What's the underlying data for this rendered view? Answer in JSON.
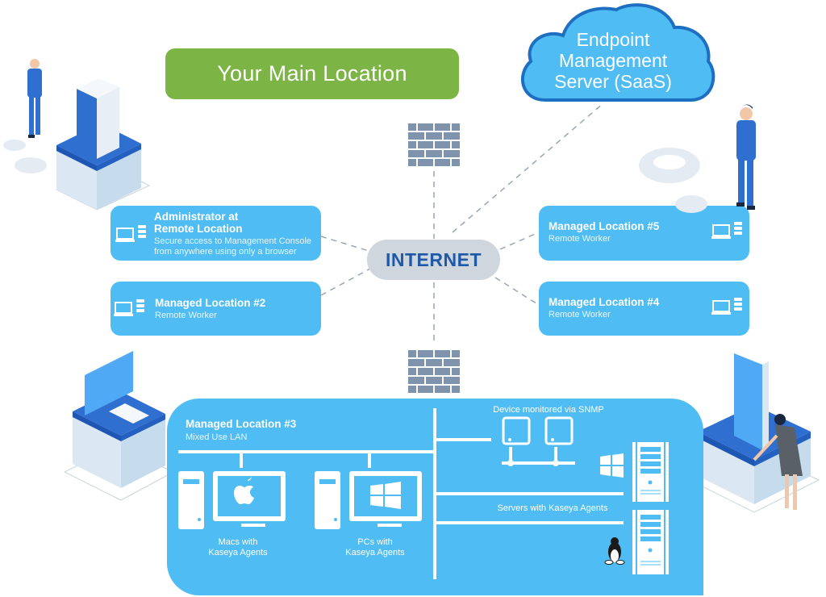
{
  "main_location": {
    "label": "Your Main Location",
    "color": "#7db446"
  },
  "cloud": {
    "lines": [
      "Endpoint",
      "Management",
      "Server (SaaS)"
    ],
    "fill": "#4fbdf3",
    "stroke": "#1e6fc2"
  },
  "internet": {
    "label": "INTERNET",
    "color": "#1e5aa8"
  },
  "cards": [
    {
      "title_lines": [
        "Administrator at",
        "Remote Location"
      ],
      "subtitle_lines": [
        "Secure access to Management Console",
        "from anywhere using only a browser"
      ],
      "icon": "laptop-server-icon"
    },
    {
      "title_lines": [
        "Managed Location #2"
      ],
      "subtitle_lines": [
        "Remote Worker"
      ],
      "icon": "laptop-server-icon"
    },
    {
      "title_lines": [
        "Managed Location #5"
      ],
      "subtitle_lines": [
        "Remote Worker"
      ],
      "icon": "laptop-server-icon"
    },
    {
      "title_lines": [
        "Managed Location #4"
      ],
      "subtitle_lines": [
        "Remote Worker"
      ],
      "icon": "laptop-server-icon"
    }
  ],
  "lan": {
    "title": "Managed Location #3",
    "subtitle": "Mixed Use LAN",
    "macs_label": [
      "Macs with",
      "Kaseya Agents"
    ],
    "pcs_label": [
      "PCs with",
      "Kaseya Agents"
    ],
    "snmp_label": "Device monitored via SNMP",
    "servers_label": "Servers with Kaseya Agents",
    "icons": [
      "apple-icon",
      "windows-icon",
      "windows-icon",
      "linux-penguin-icon"
    ]
  },
  "colors": {
    "card_blue": "#4fbdf3",
    "firewall": "#7f93ad",
    "dash": "#9aa5b3"
  }
}
